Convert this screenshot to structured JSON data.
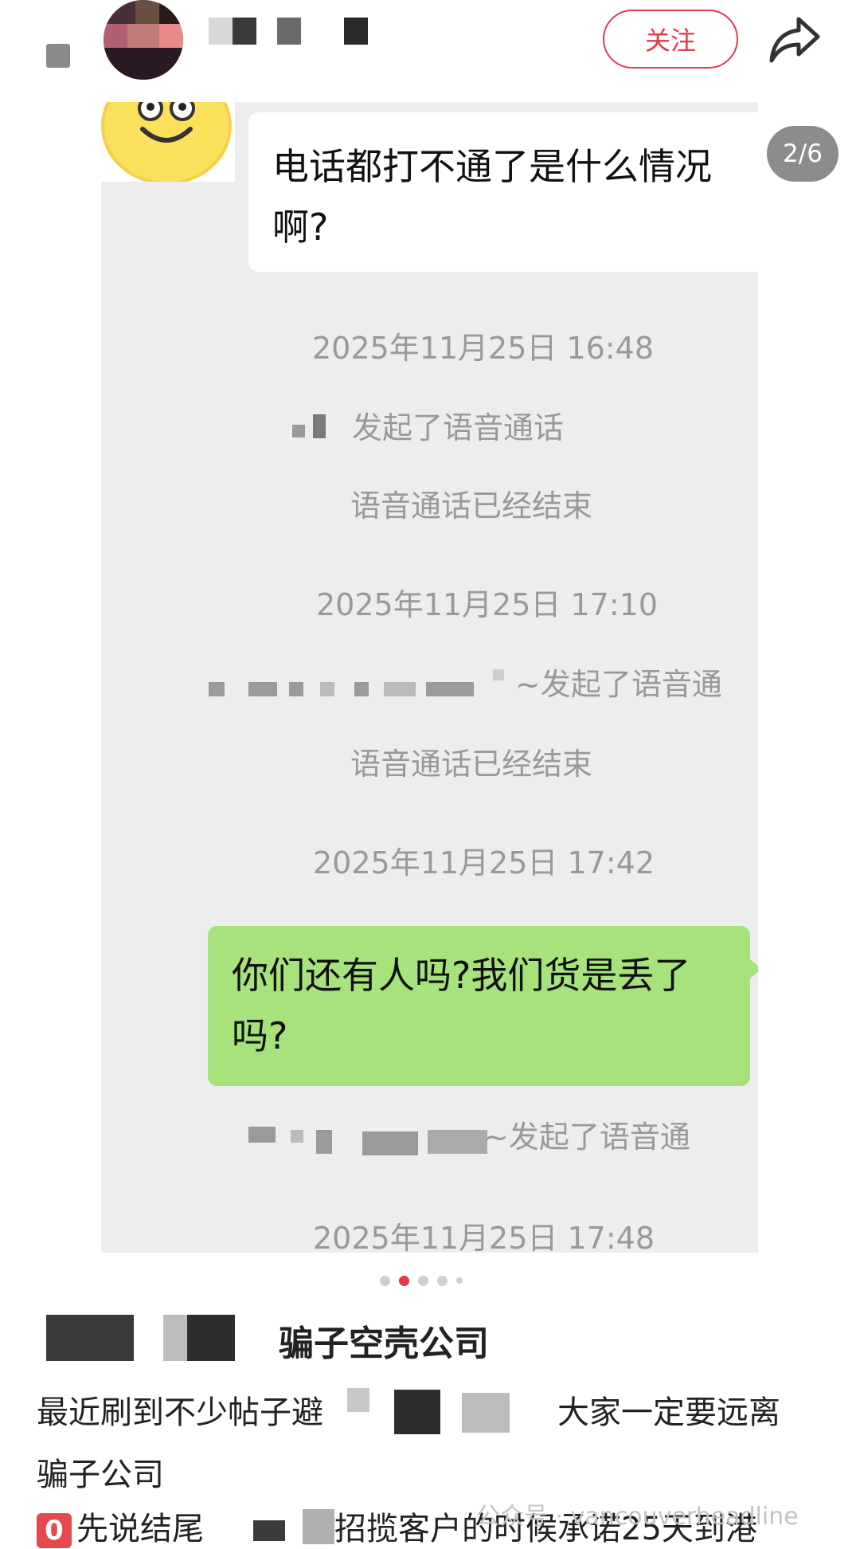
{
  "header": {
    "follow_label": "关注",
    "share_icon": "share-arrow-icon"
  },
  "slide": {
    "counter": "2/6",
    "incoming_message": "电话都打不通了是什么情况啊?",
    "outgoing_message": "你们还有人吗?我们货是丢了吗?",
    "events": {
      "ts1": "2025年11月25日 16:48",
      "call1": "发起了语音通话",
      "end1": "语音通话已经结束",
      "ts2": "2025年11月25日 17:10",
      "call2": "~发起了语音通",
      "end2": "语音通话已经结束",
      "ts3": "2025年11月25日 17:42",
      "call3": "~发起了语音通",
      "ts4": "2025年11月25日 17:48"
    }
  },
  "pagination": {
    "count": 5,
    "active_index": 1
  },
  "post": {
    "title_suffix": "骗子空壳公司",
    "line1_a": "最近刷到不少帖子避",
    "line1_b": "大家一定要远离",
    "line2": "骗子公司",
    "line3_badge": "0",
    "line3_a": "先说结尾",
    "line3_b": "招揽客户的时候承诺25天到港"
  },
  "watermark": "公众号 · vancouverheadline",
  "colors": {
    "accent": "#e33a4b",
    "bubble_green": "#a7e27d",
    "chat_bg": "#ededed"
  }
}
